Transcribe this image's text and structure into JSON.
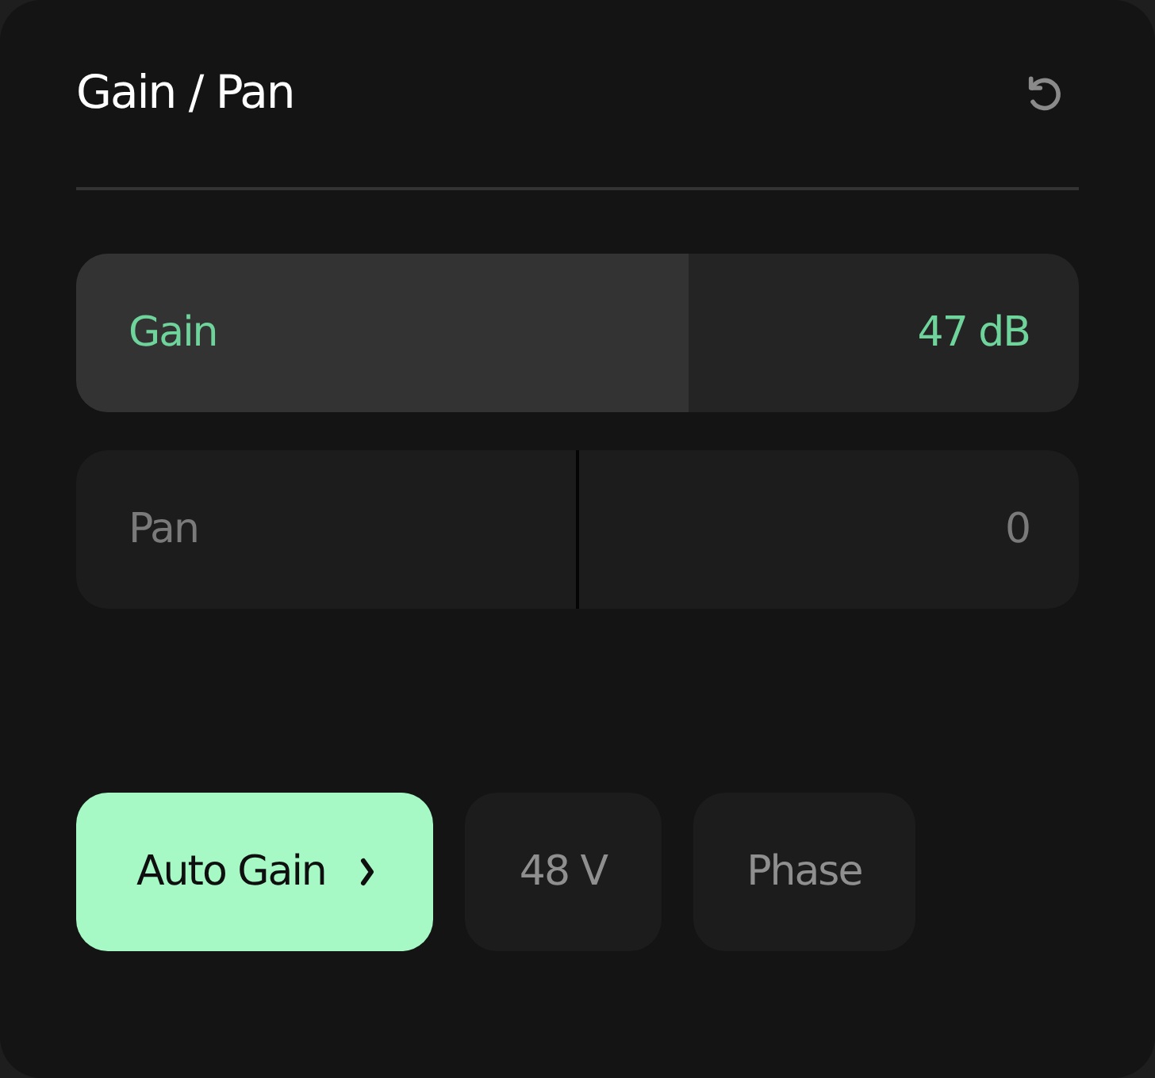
{
  "panel": {
    "title": "Gain / Pan"
  },
  "sliders": [
    {
      "kind": "fill",
      "label": "Gain",
      "reading": "47 dB",
      "active": true,
      "level": 0.61
    },
    {
      "kind": "bipolar",
      "label": "Pan",
      "reading": "0",
      "active": false,
      "level": 0.5
    }
  ],
  "buttons": [
    {
      "kind": "menu",
      "label": "Auto Gain",
      "on": true
    },
    {
      "kind": "toggle",
      "label": "48 V",
      "on": false
    },
    {
      "kind": "toggle",
      "label": "Phase",
      "on": false
    }
  ]
}
